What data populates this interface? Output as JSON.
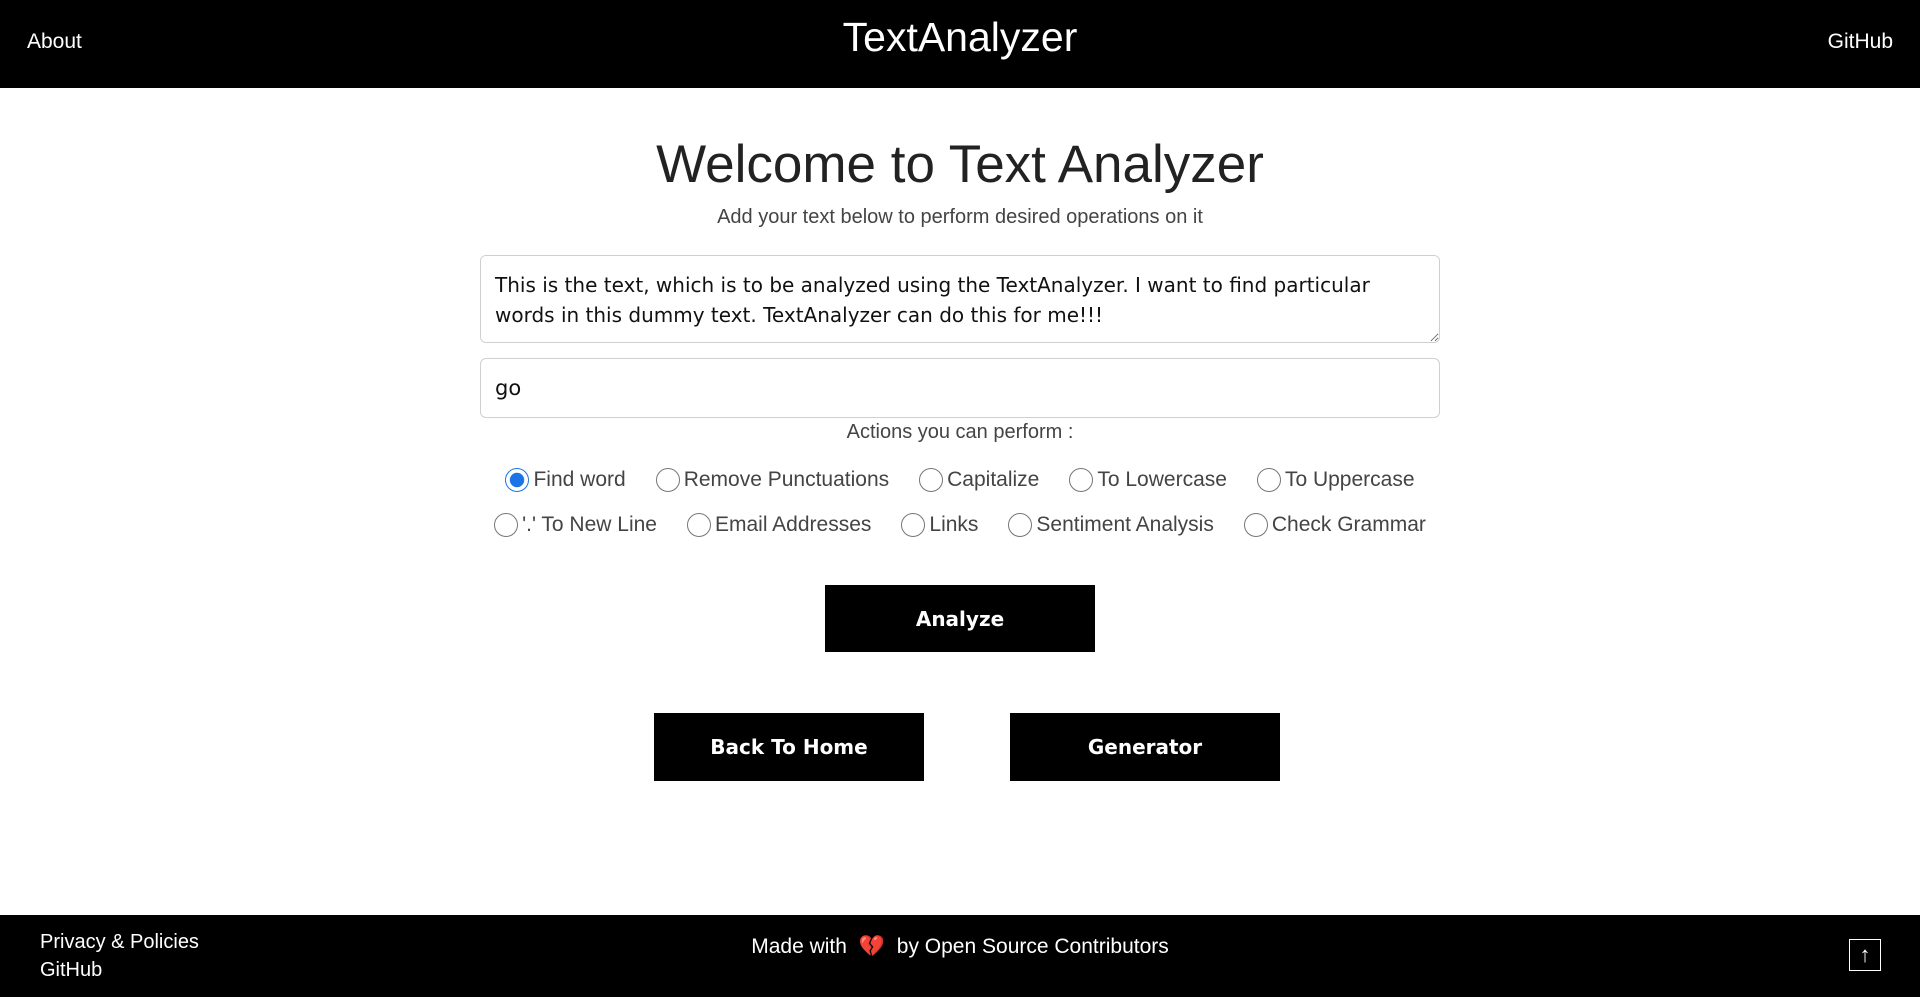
{
  "header": {
    "about": "About",
    "brand": "TextAnalyzer",
    "github": "GitHub"
  },
  "main": {
    "title": "Welcome to Text Analyzer",
    "subtitle": "Add your text below to perform desired operations on it",
    "textarea_value": "This is the text, which is to be analyzed using the TextAnalyzer. I want to find particular words in this dummy text. TextAnalyzer can do this for me!!!",
    "search_value": "go",
    "actions_title": "Actions you can perform :",
    "options_row1": [
      "Find word",
      "Remove Punctuations",
      "Capitalize",
      "To Lowercase",
      "To Uppercase"
    ],
    "options_row2": [
      "'.' To New Line",
      "Email Addresses",
      "Links",
      "Sentiment Analysis",
      "Check Grammar"
    ],
    "selected_option": "Find word",
    "analyze_button": "Analyze",
    "home_button": "Back To Home",
    "generator_button": "Generator"
  },
  "footer": {
    "privacy": "Privacy & Policies",
    "github": "GitHub",
    "made_prefix": "Made with",
    "heart": "💔",
    "made_suffix": "by Open Source Contributors",
    "top_button": "↑"
  },
  "colors": {
    "header_bg": "#000000",
    "radio_accent": "#1a73e8",
    "heart": "#e53945"
  }
}
